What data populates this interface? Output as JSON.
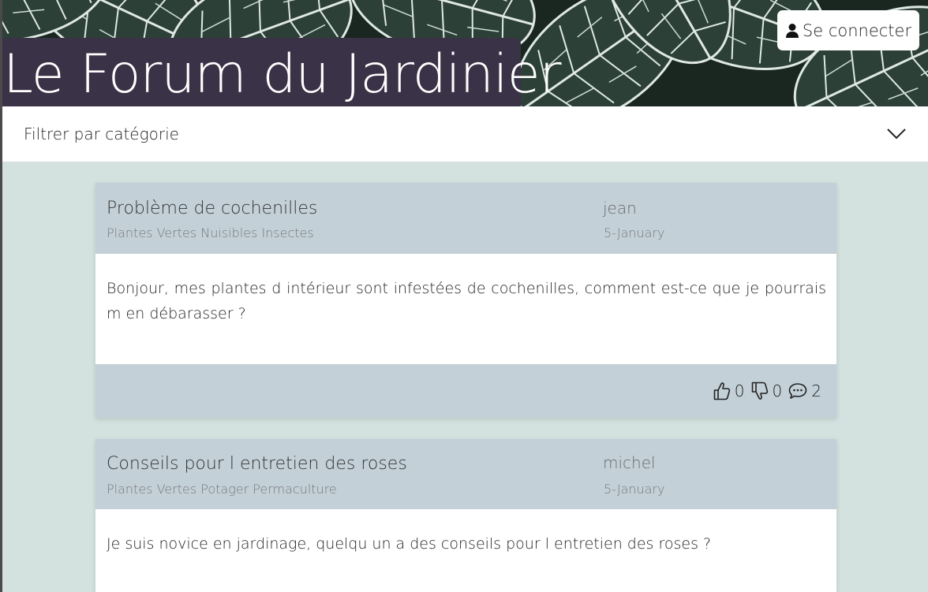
{
  "site": {
    "title": "Le Forum du Jardinier"
  },
  "header": {
    "login_label": "Se connecter"
  },
  "filter": {
    "label": "Filtrer par catégorie"
  },
  "posts": [
    {
      "title": "Problème de cochenilles",
      "tags": "Plantes Vertes Nuisibles Insectes",
      "author": "jean",
      "date": "5-January",
      "body": "Bonjour, mes plantes d intérieur sont infestées de cochenilles, comment est-ce que je pourrais m en débarasser ?",
      "likes": "0",
      "dislikes": "0",
      "comments": "2"
    },
    {
      "title": "Conseils pour l entretien des roses",
      "tags": "Plantes Vertes Potager Permaculture",
      "author": "michel",
      "date": "5-January",
      "body": "Je suis novice en jardinage, quelqu un a des conseils pour l entretien des roses ?"
    }
  ],
  "colors": {
    "page_background": "#d3e1df",
    "title_box": "#3a3246",
    "card_header": "#c3d0d8",
    "card_body": "#ffffff"
  }
}
